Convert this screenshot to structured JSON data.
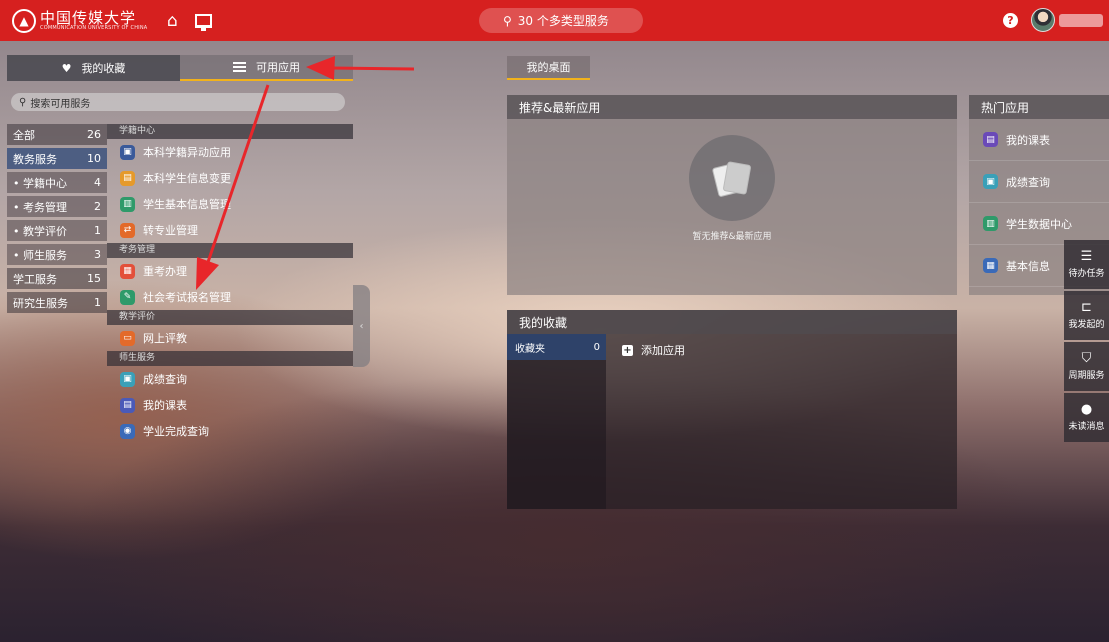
{
  "topbar": {
    "logo_cn": "中国传媒大学",
    "logo_en": "COMMUNICATION UNIVERSITY OF CHINA",
    "search_label": "30 个多类型服务"
  },
  "left": {
    "tab_favorites": "我的收藏",
    "tab_apps": "可用应用",
    "search_placeholder": "搜索可用服务",
    "categories": [
      {
        "label": "全部",
        "count": "26"
      },
      {
        "label": "教务服务",
        "count": "10"
      },
      {
        "label": "• 学籍中心",
        "count": "4"
      },
      {
        "label": "• 考务管理",
        "count": "2"
      },
      {
        "label": "• 教学评价",
        "count": "1"
      },
      {
        "label": "• 师生服务",
        "count": "3"
      },
      {
        "label": "学工服务",
        "count": "15"
      },
      {
        "label": "研究生服务",
        "count": "1"
      }
    ],
    "groups": [
      {
        "title": "学籍中心",
        "items": [
          "本科学籍异动应用",
          "本科学生信息变更",
          "学生基本信息管理",
          "转专业管理"
        ]
      },
      {
        "title": "考务管理",
        "items": [
          "重考办理",
          "社会考试报名管理"
        ]
      },
      {
        "title": "教学评价",
        "items": [
          "网上评教"
        ]
      },
      {
        "title": "师生服务",
        "items": [
          "成绩查询",
          "我的课表",
          "学业完成查询"
        ]
      }
    ]
  },
  "desktop": {
    "tab": "我的桌面",
    "recommend_title": "推荐&最新应用",
    "recommend_empty": "暂无推荐&最新应用",
    "favorites_title": "我的收藏",
    "folder_label": "收藏夹",
    "folder_count": "0",
    "add_app": "添加应用",
    "hot_title": "热门应用",
    "hot_items": [
      "我的课表",
      "成绩查询",
      "学生数据中心",
      "基本信息"
    ]
  },
  "quickbar": [
    "待办任务",
    "我发起的",
    "周期服务",
    "未读消息"
  ],
  "colors": {
    "brand_red": "#d6201f",
    "accent_yellow": "#f2b21b",
    "active_blue": "#2d4878",
    "arrow_red": "#e8262a"
  }
}
